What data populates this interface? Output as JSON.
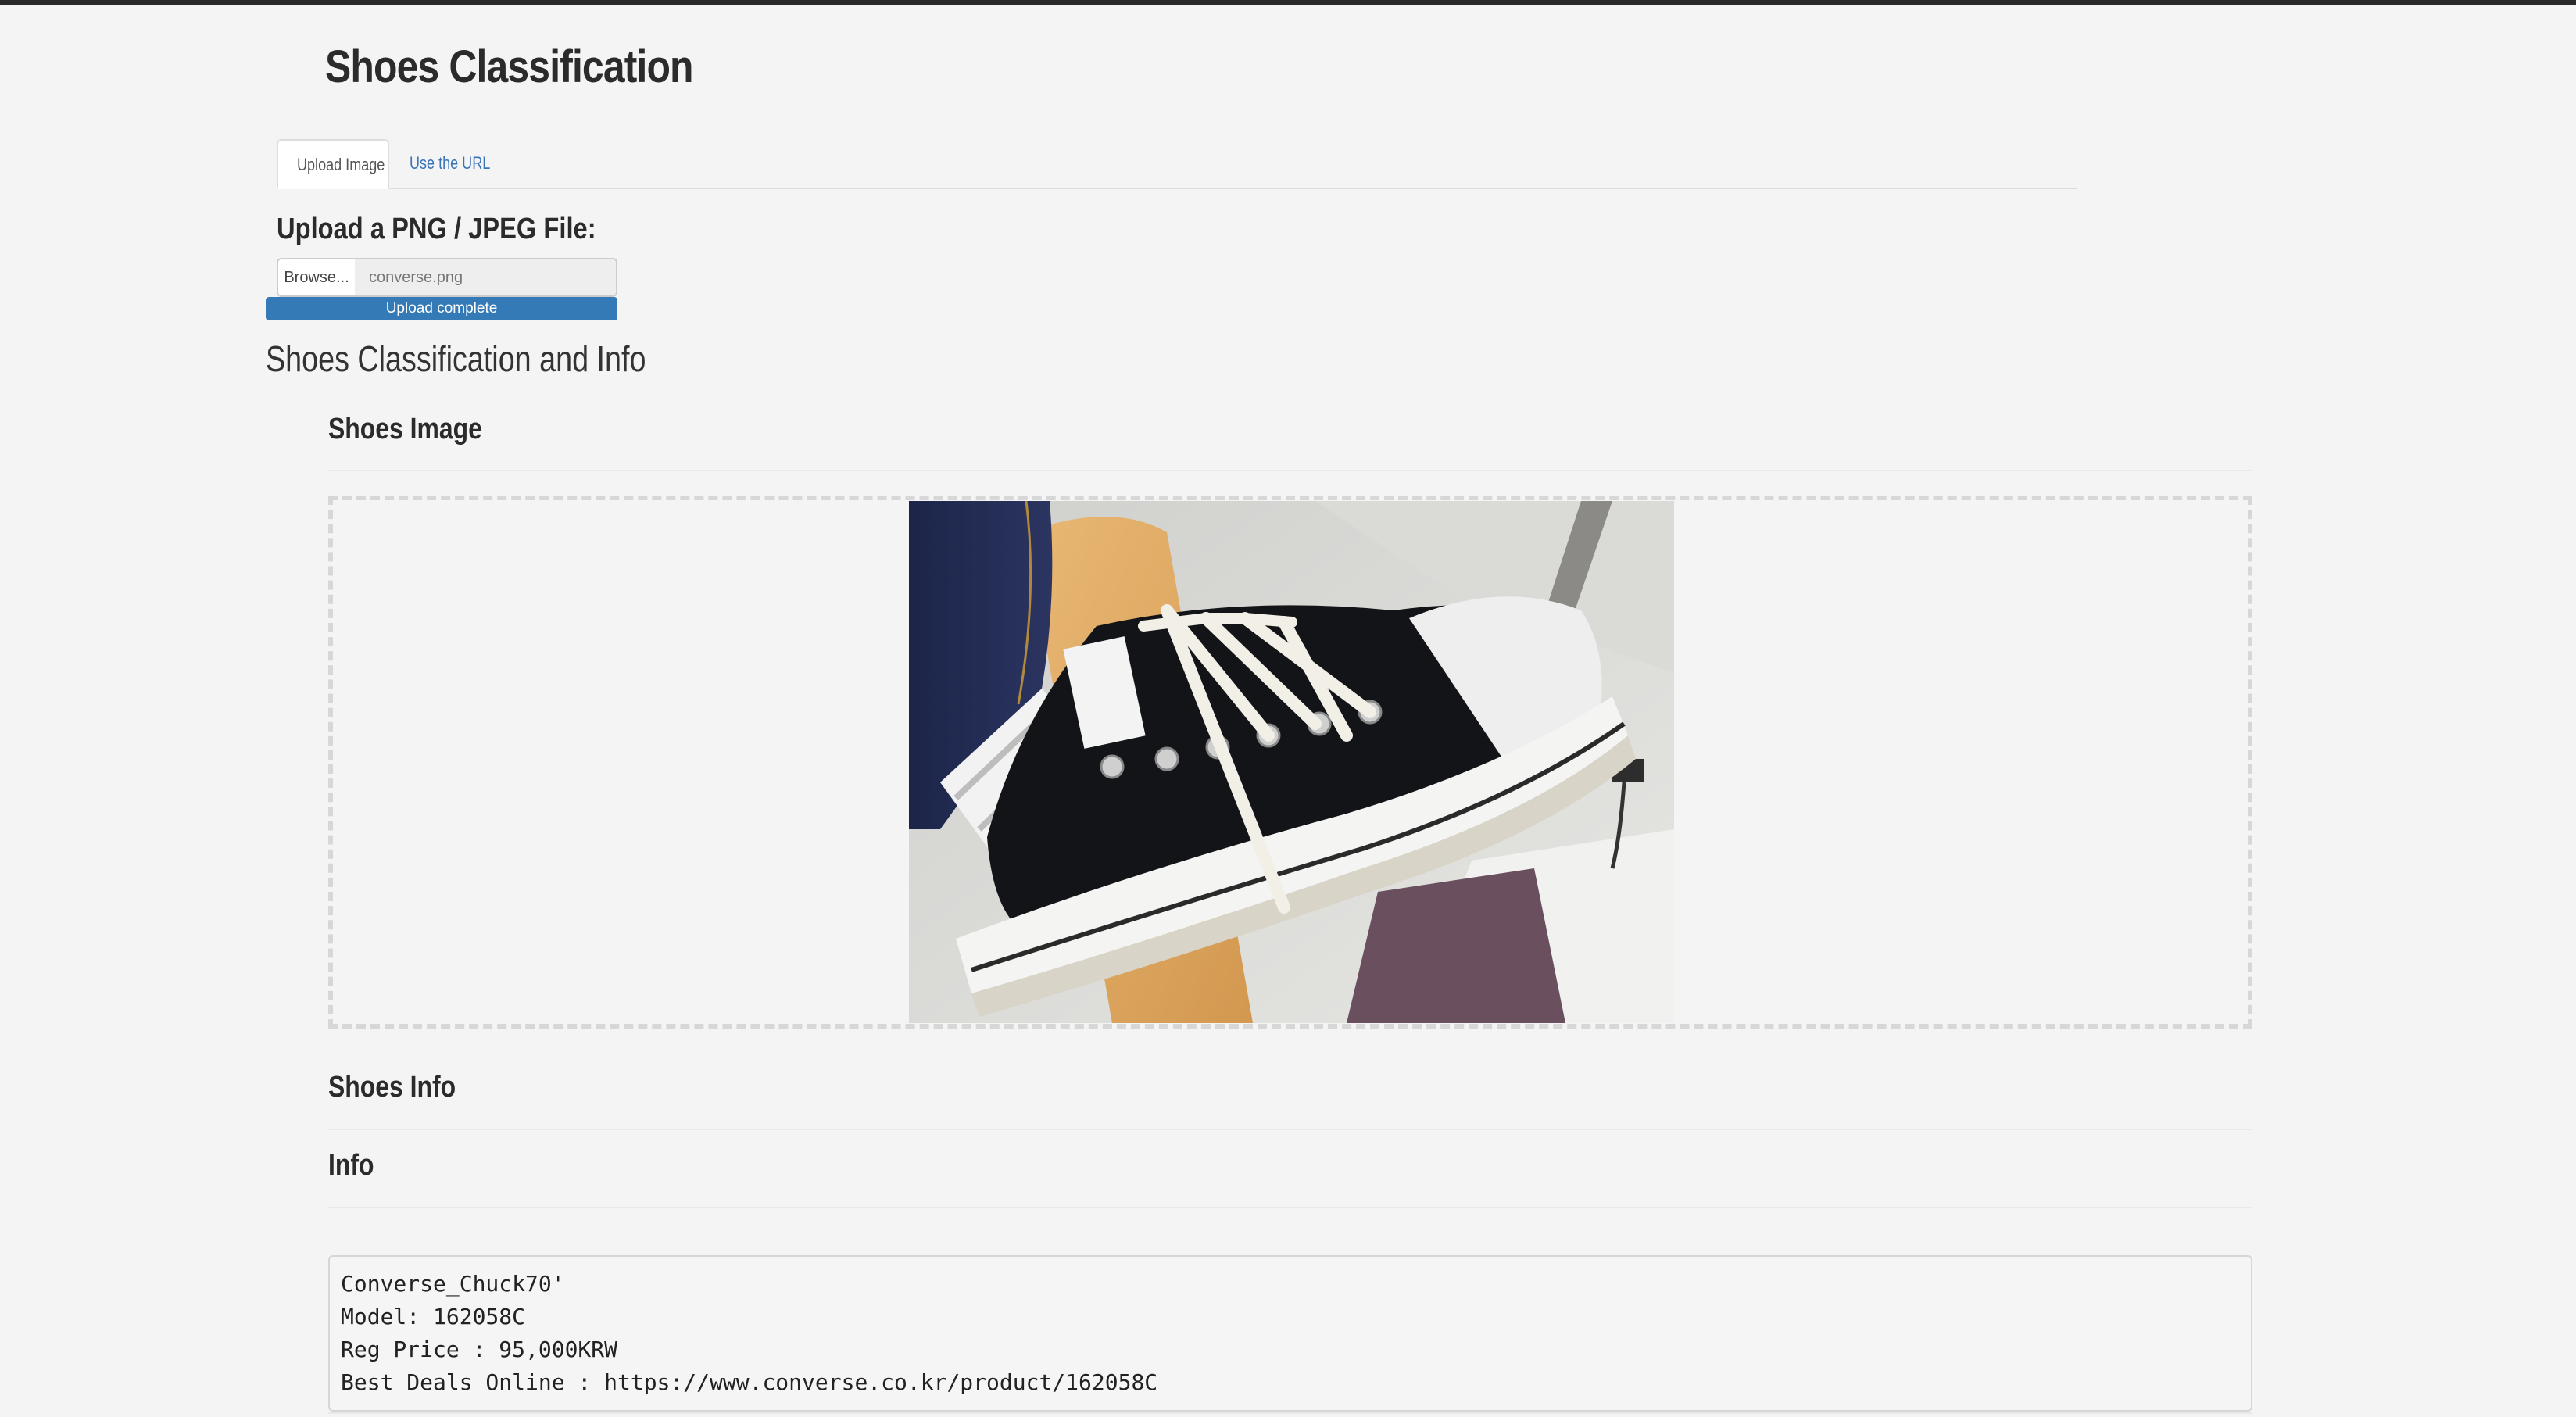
{
  "app": {
    "title": "Shoes Classification"
  },
  "tabs": [
    {
      "label": "Upload Image",
      "active": true
    },
    {
      "label": "Use the URL",
      "active": false
    }
  ],
  "upload": {
    "label": "Upload a PNG / JPEG File:",
    "browse_label": "Browse...",
    "file_name": "converse.png",
    "progress_label": "Upload complete",
    "progress_percent": 100
  },
  "results": {
    "section_title": "Shoes Classification and Info",
    "image_heading": "Shoes Image",
    "shoes_info_heading": "Shoes Info",
    "info_heading": "Info",
    "info_lines": [
      "Converse_Chuck70'",
      "Model: 162058C",
      "Reg Price : 95,000KRW",
      "Best Deals Online : https://www.converse.co.kr/product/162058C"
    ]
  },
  "colors": {
    "background": "#f4f4f4",
    "accent": "#337ab7",
    "tab_link": "#3a74b8",
    "top_bar": "#2a2a2a"
  }
}
